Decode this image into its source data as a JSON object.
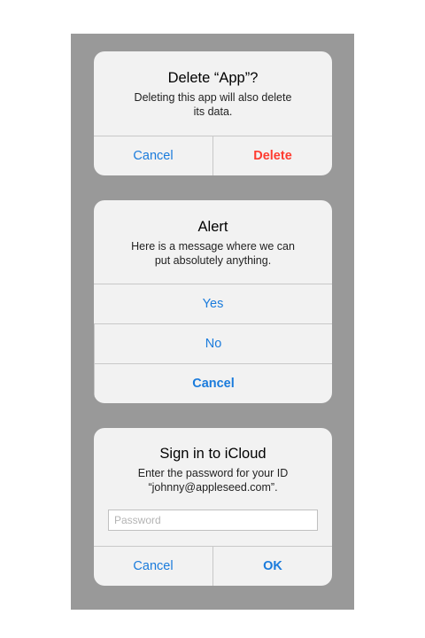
{
  "delete_alert": {
    "title": "Delete “App”?",
    "message_line1": "Deleting this app will also delete",
    "message_line2": "its data.",
    "cancel_label": "Cancel",
    "delete_label": "Delete"
  },
  "generic_alert": {
    "title": "Alert",
    "message_line1": "Here is a message where we can",
    "message_line2": "put absolutely anything.",
    "buttons": [
      {
        "label": "Yes"
      },
      {
        "label": "No"
      },
      {
        "label": "Cancel"
      }
    ]
  },
  "signin_alert": {
    "title": "Sign in to iCloud",
    "message_line1": "Enter the password for your ID",
    "message_line2": "“johnny@appleseed.com”.",
    "password_placeholder": "Password",
    "password_value": "",
    "cancel_label": "Cancel",
    "ok_label": "OK"
  },
  "colors": {
    "backdrop": "#999999",
    "alert_background": "#f2f2f2",
    "action_blue": "#1a7bdc",
    "destructive_red": "#fe3b30",
    "separator": "#c8c8c8"
  }
}
